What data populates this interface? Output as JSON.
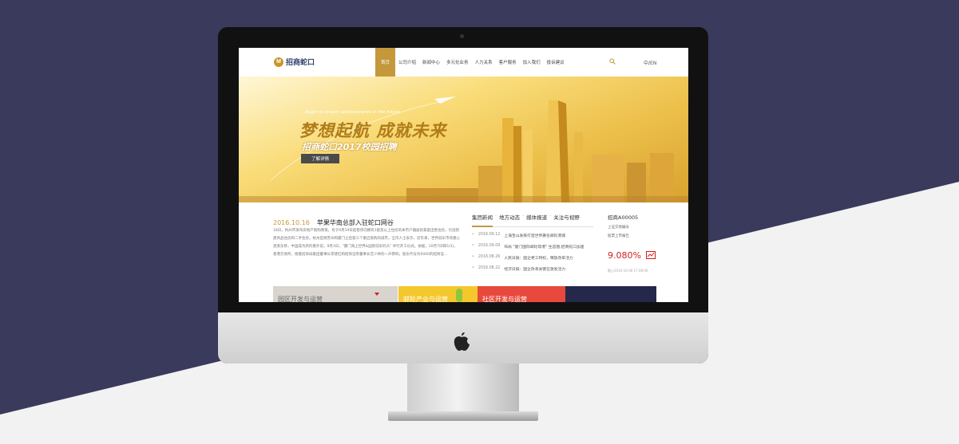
{
  "site": {
    "logo_mark": "M",
    "logo_text": "招商蛇口",
    "nav": [
      "首页",
      "公司介绍",
      "新闻中心",
      "多元化业务",
      "人力关系",
      "客户服务",
      "加入我们",
      "投诉建议"
    ],
    "lang": "中/EN",
    "banner": {
      "tagline_en": "Begin to dream achievements in the future",
      "slogan": "梦想起航 成就未来",
      "sub_slogan": "招商蛇口2017校园招聘",
      "button": "了解详情"
    },
    "news": {
      "date": "2016.10.16",
      "title": "苹果华南总部入驻蛇口网谷",
      "body": "18日，杭州市发布房地产限购政策。有于9月19日起暂停向拥有1套及以上住房的本市户籍居民家庭出售住房，包括新建商品住房和二手住房。杭州是继苏州和厦门之后第三个重启限购的城市，全内人士表示，近年来，世界前彩市场重心逐渐东移，中国成为新的重外前，9月3日，\"厦门海上世界&国际前彩码头\" 举行开工仪式。依据，10月7日辉5(3)，香港交易所，搜着招商局集团董事长李建红和招商证券董事长宫少林的一声锣响，股份代号为0000的招商证..."
    },
    "tabs": [
      "集团新闻",
      "地方动态",
      "媒体报道",
      "关注与视野"
    ],
    "list": [
      {
        "date": "2016.09.12",
        "text": "上海宝山发挥打造世界著名邮轮港城"
      },
      {
        "date": "2016.09.09",
        "text": "布局 \"厦门国际邮轮母港\" 生态圈,招商蛇口加速"
      },
      {
        "date": "2016.08.26",
        "text": "人民日报：国企党工特权，释放改革活力"
      },
      {
        "date": "2016.08.22",
        "text": "经济日报：国企改革关键在激发活力"
      }
    ],
    "stock": {
      "name": "招商A00005",
      "sub1": "上证交易编号",
      "sub2": "股票上市报告",
      "value": "9.080%",
      "time": "截止2016-10-08 17:08:09"
    },
    "tiles": [
      "园区开发与运营",
      "邮轮产业与运营",
      "社区开发与运营",
      ""
    ]
  },
  "colors": {
    "accent": "#c4983b",
    "navy": "#2d3e6b",
    "red": "#d21f1f"
  }
}
